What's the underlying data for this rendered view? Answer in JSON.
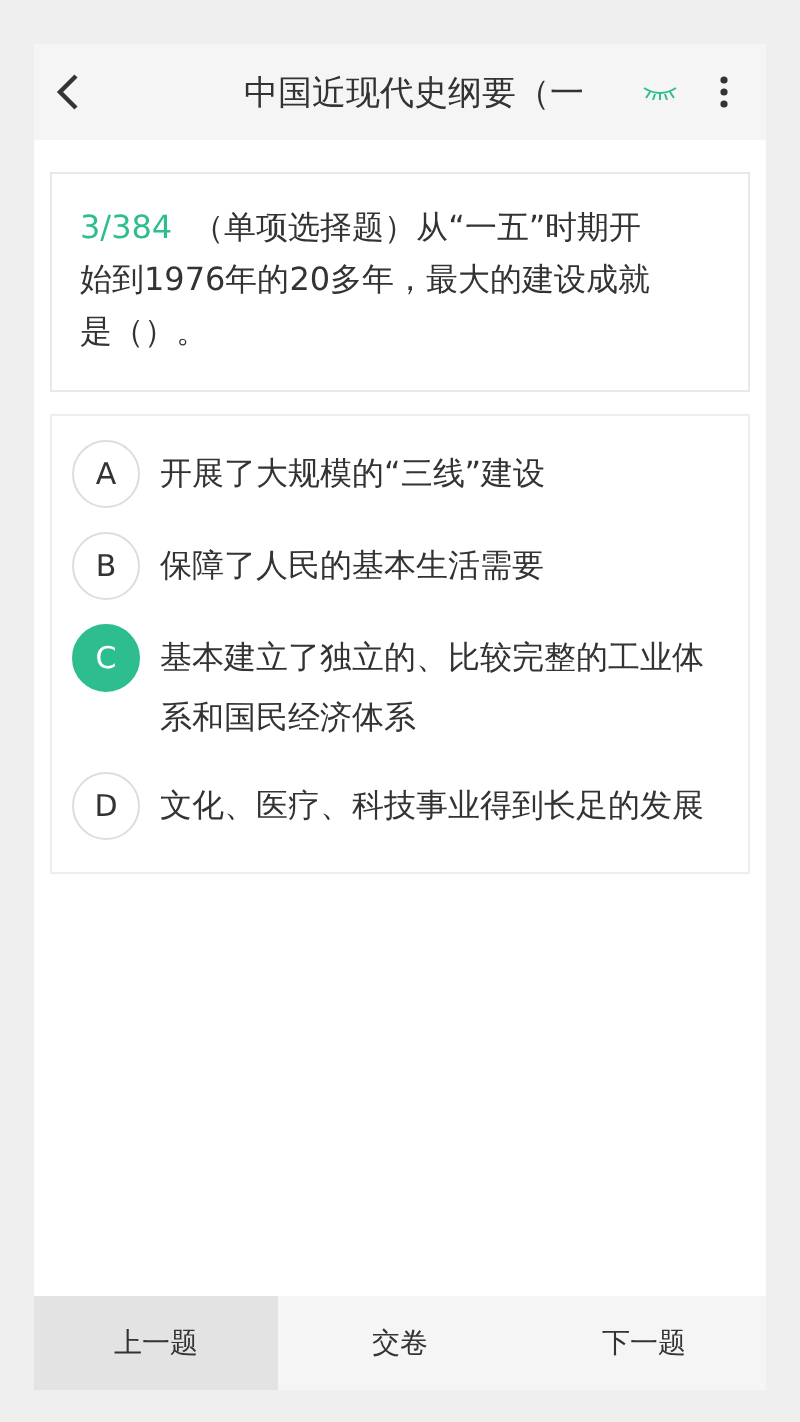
{
  "header": {
    "title": "中国近现代史纲要（一"
  },
  "question": {
    "progress": "3/384",
    "text": "（单项选择题）从“一五”时期开始到1976年的20多年，最大的建设成就是（）。"
  },
  "options": [
    {
      "letter": "A",
      "text": "开展了大规模的“三线”建设",
      "selected": false
    },
    {
      "letter": "B",
      "text": "保障了人民的基本生活需要",
      "selected": false
    },
    {
      "letter": "C",
      "text": "基本建立了独立的、比较完整的工业体系和国民经济体系",
      "selected": true
    },
    {
      "letter": "D",
      "text": "文化、医疗、科技事业得到长足的发展",
      "selected": false
    }
  ],
  "footer": [
    {
      "label": "上一题",
      "kind": "shaded"
    },
    {
      "label": "交卷",
      "kind": "plain"
    },
    {
      "label": "下一题",
      "kind": "plain"
    }
  ]
}
